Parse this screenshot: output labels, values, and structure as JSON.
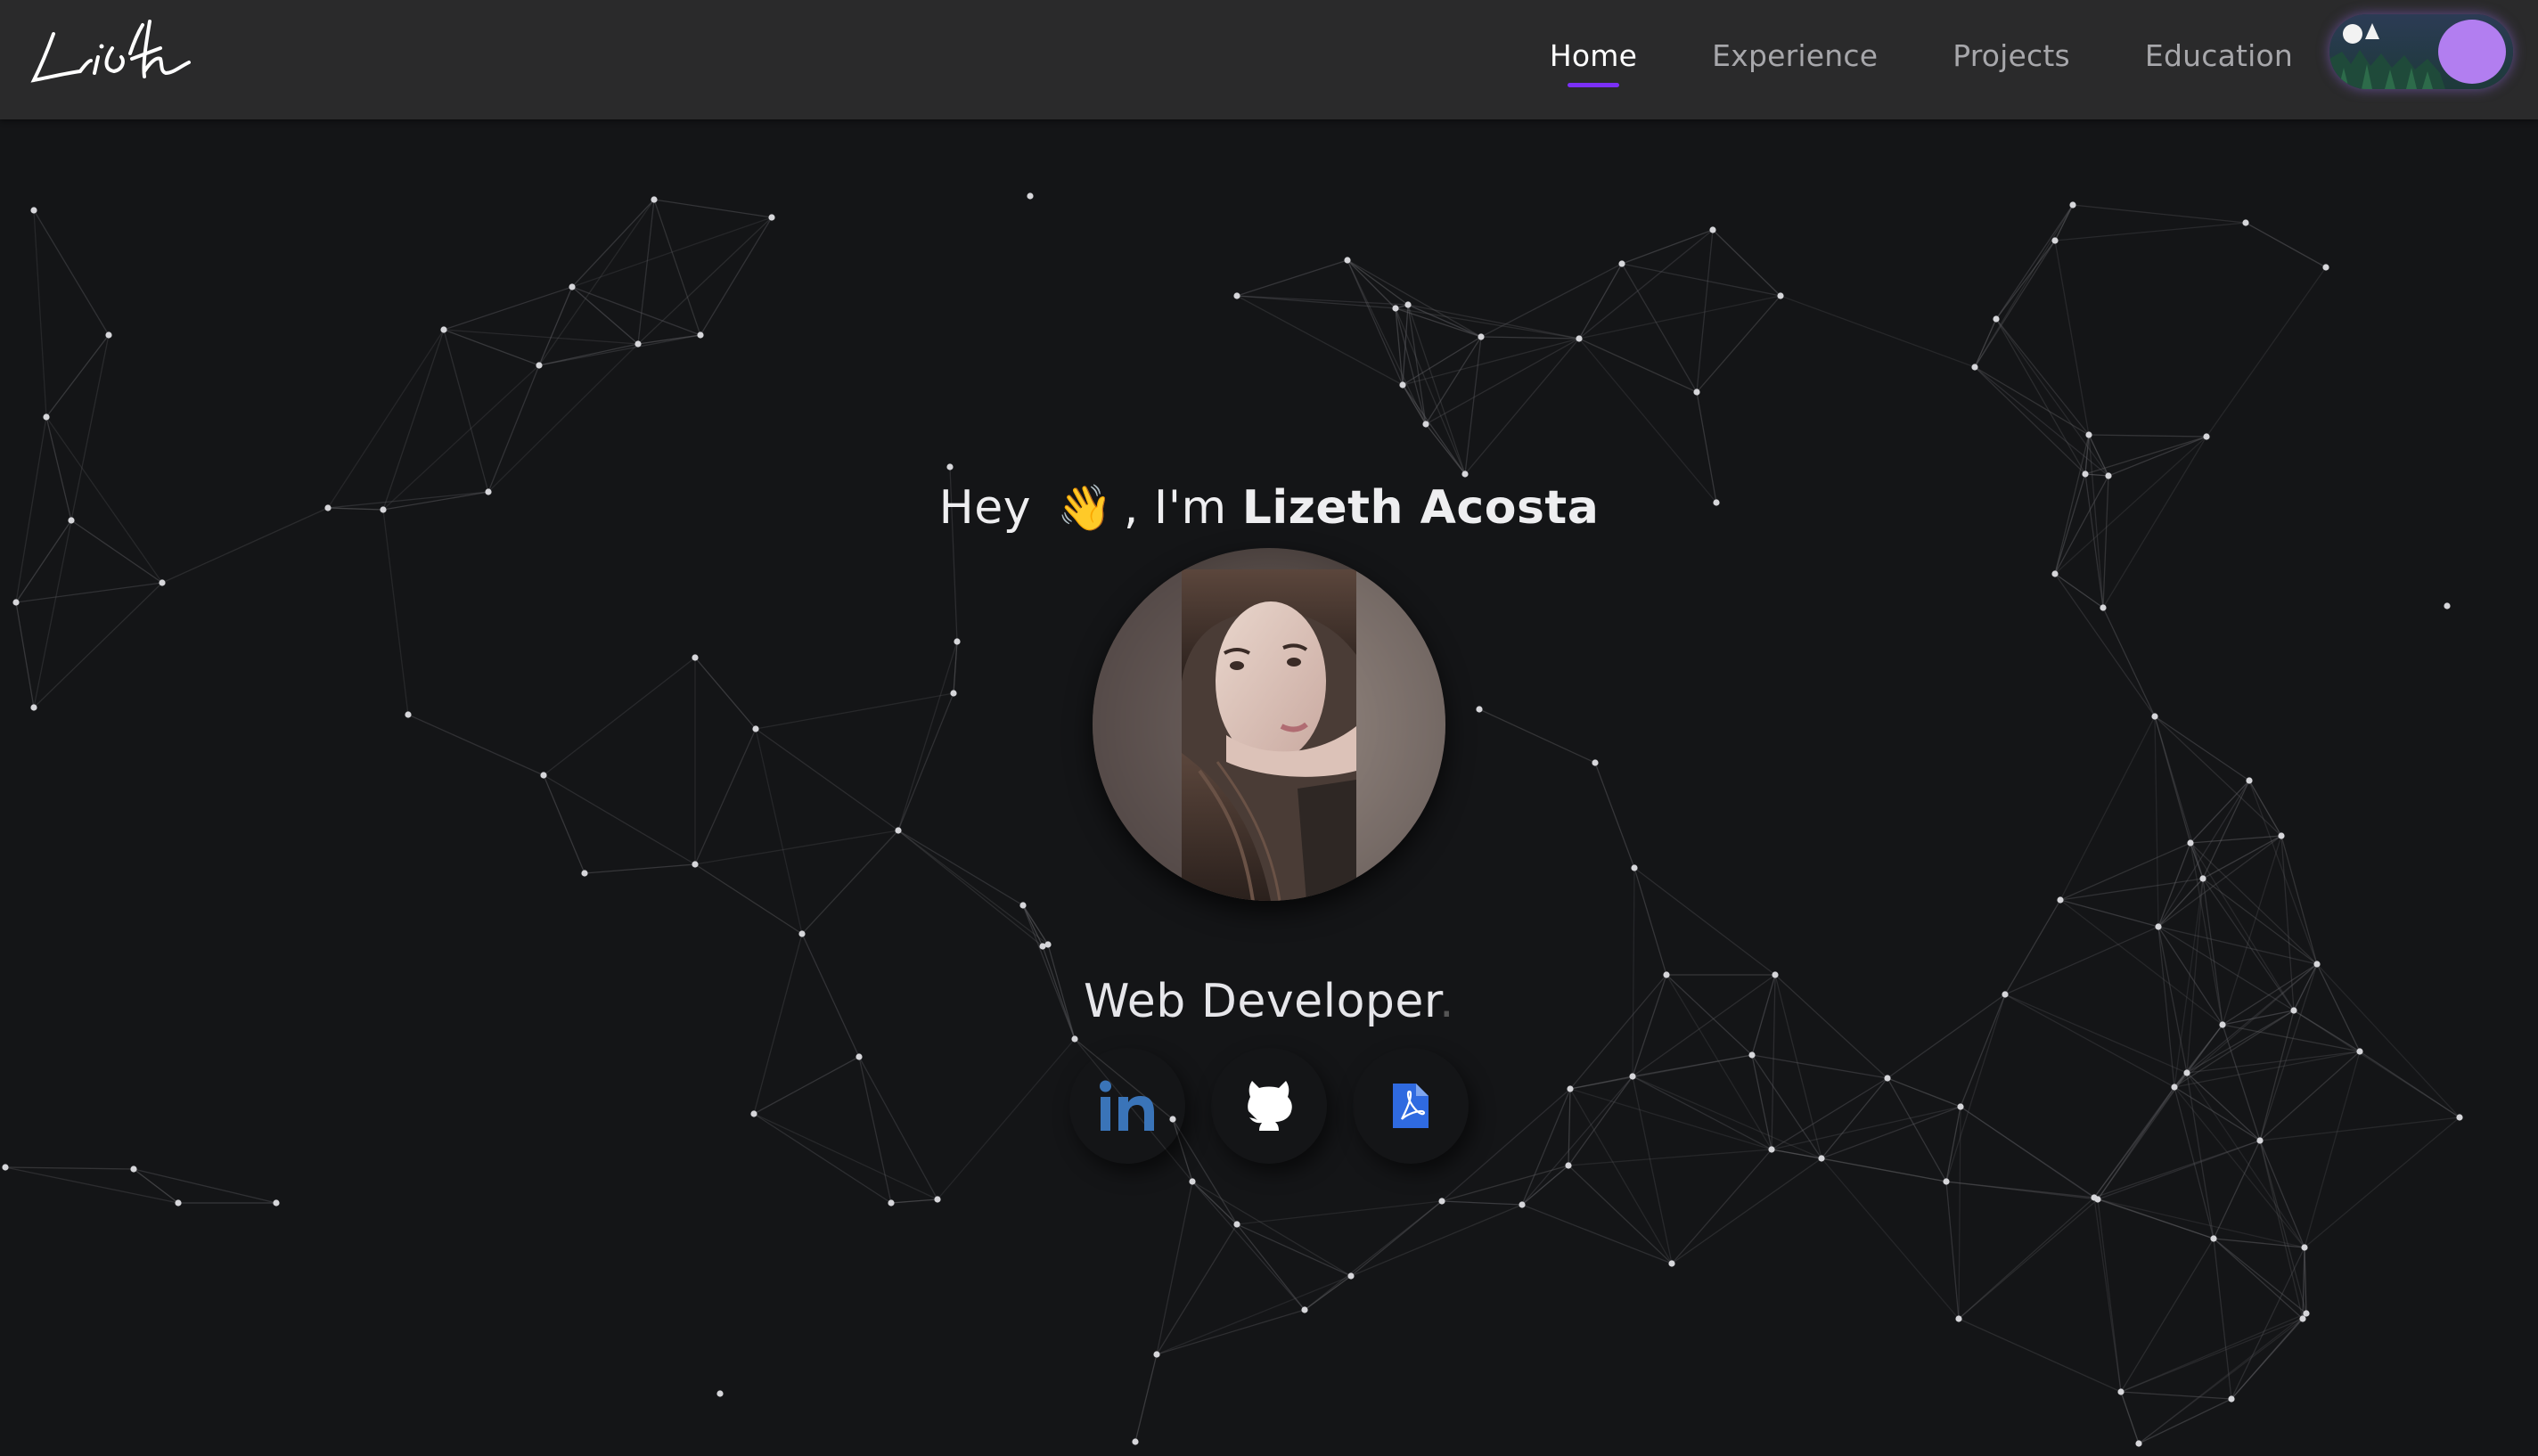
{
  "nav": {
    "logo_text": "Lizeth",
    "links": [
      {
        "label": "Home",
        "active": true
      },
      {
        "label": "Experience",
        "active": false
      },
      {
        "label": "Projects",
        "active": false
      },
      {
        "label": "Education",
        "active": false
      }
    ],
    "theme_toggle": {
      "state": "dark"
    }
  },
  "hero": {
    "greeting_prefix": "Hey",
    "wave_emoji": "👋",
    "greeting_mid": ", I'm",
    "name": "Lizeth Acosta",
    "role": "Web Developer",
    "role_cursor": "."
  },
  "social": [
    {
      "name": "linkedin-icon",
      "glyph": "in",
      "color": "#3a74b8"
    },
    {
      "name": "github-icon",
      "color": "#ffffff"
    },
    {
      "name": "pdf-resume-icon",
      "color": "#2f6ae0"
    }
  ],
  "colors": {
    "background": "#141517",
    "navbar": "#2a2a2b",
    "accent": "#7b2ff7",
    "toggle_knob": "#b27ef0",
    "network": "#5a5a5e"
  }
}
